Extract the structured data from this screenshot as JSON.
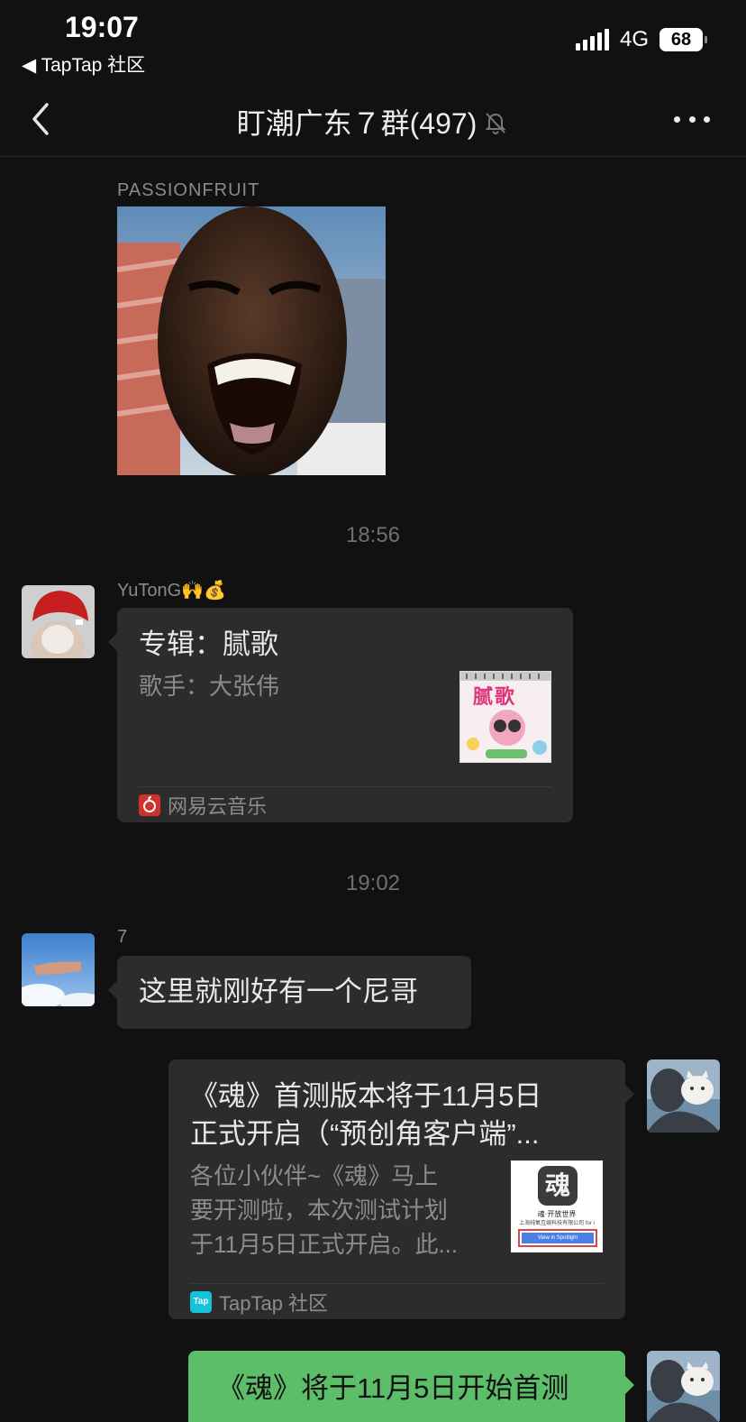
{
  "status_bar": {
    "time": "19:07",
    "back_app": "◀ TapTap 社区",
    "network": "4G",
    "battery": "68"
  },
  "header": {
    "title": "盯潮广东７群(497)",
    "icons": {
      "back": "chevron-left-icon",
      "mute": "bell-slash-icon",
      "more": "more-dots-icon"
    }
  },
  "messages": [
    {
      "sender": "PASSIONFRUIT",
      "type": "image"
    },
    {
      "time_separator": "18:56"
    },
    {
      "sender": "YuTonG🙌💰",
      "type": "music_card",
      "title": "专辑：腻歌",
      "subtitle": "歌手：大张伟",
      "cover_text": "腻歌",
      "source": "网易云音乐"
    },
    {
      "time_separator": "19:02"
    },
    {
      "sender": "7",
      "type": "text",
      "text": "这里就刚好有一个尼哥"
    },
    {
      "sender": "me",
      "type": "link_card",
      "title_line1": "《魂》首测版本将于11月5日",
      "title_line2": "正式开启（“预创角客户端”...",
      "desc_line1": "各位小伙伴~《魂》马上",
      "desc_line2": "要开测啦，本次测试计划",
      "desc_line3": "于11月5日正式开启。此...",
      "thumb_logo": "魂",
      "thumb_line1": "魂·开放世界",
      "thumb_line2": "上海纯氧互娱科技有限公司 for i",
      "thumb_button": "View in Spotlight",
      "source_logo": "Tap",
      "source": "TapTap 社区"
    },
    {
      "sender": "me",
      "type": "text",
      "text": "《魂》将于11月5日开始首测"
    }
  ],
  "colors": {
    "background": "#111111",
    "bubble": "#2c2c2c",
    "own_bubble": "#5dbe6a",
    "meta_text": "#8a8a8a"
  }
}
